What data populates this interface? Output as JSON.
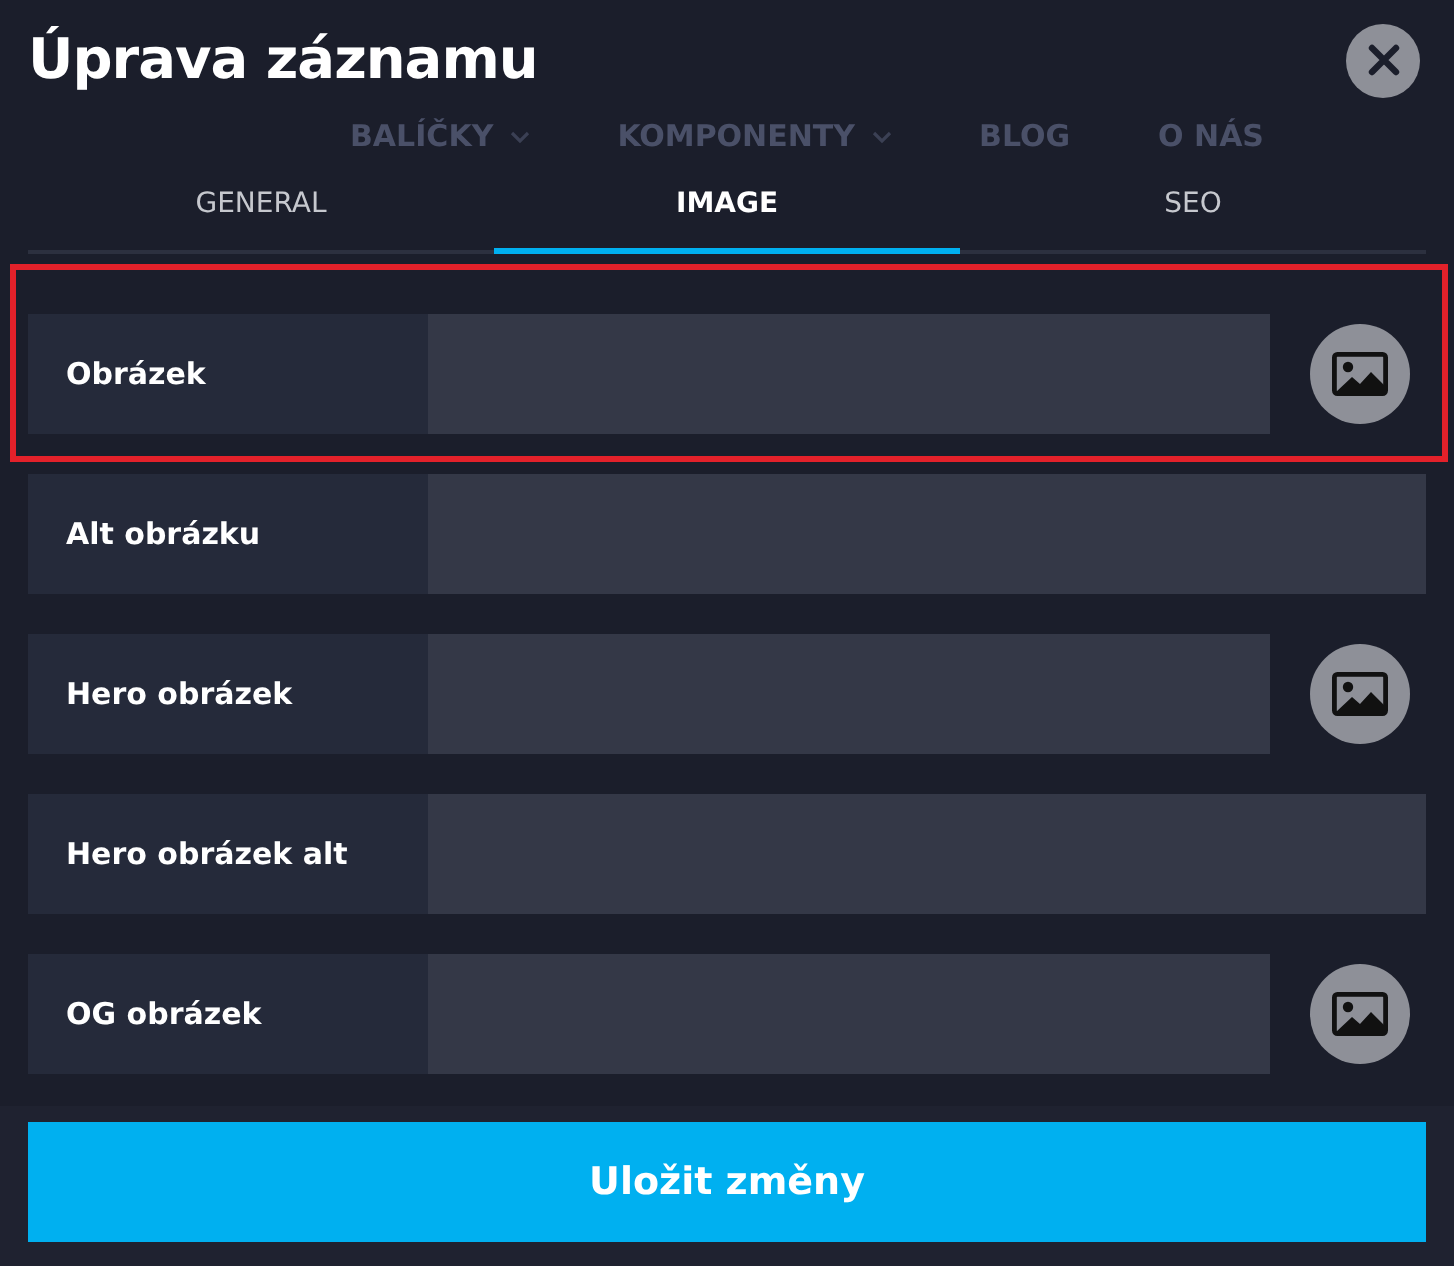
{
  "dialog": {
    "title": "Úprava záznamu"
  },
  "background_nav": [
    {
      "label": "BALÍČKY",
      "has_submenu": true
    },
    {
      "label": "KOMPONENTY",
      "has_submenu": true
    },
    {
      "label": "BLOG",
      "has_submenu": false
    },
    {
      "label": "O NÁS",
      "has_submenu": false
    }
  ],
  "tabs": [
    {
      "label": "GENERAL",
      "selected": false
    },
    {
      "label": "IMAGE",
      "selected": true
    },
    {
      "label": "SEO",
      "selected": false
    }
  ],
  "fields": [
    {
      "label": "Obrázek",
      "kind": "image",
      "highlighted": true
    },
    {
      "label": "Alt obrázku",
      "kind": "text",
      "highlighted": false
    },
    {
      "label": "Hero obrázek",
      "kind": "image",
      "highlighted": false
    },
    {
      "label": "Hero obrázek alt",
      "kind": "text",
      "highlighted": false
    },
    {
      "label": "OG obrázek",
      "kind": "image",
      "highlighted": false
    }
  ],
  "save_button": {
    "label": "Uložit změny"
  }
}
